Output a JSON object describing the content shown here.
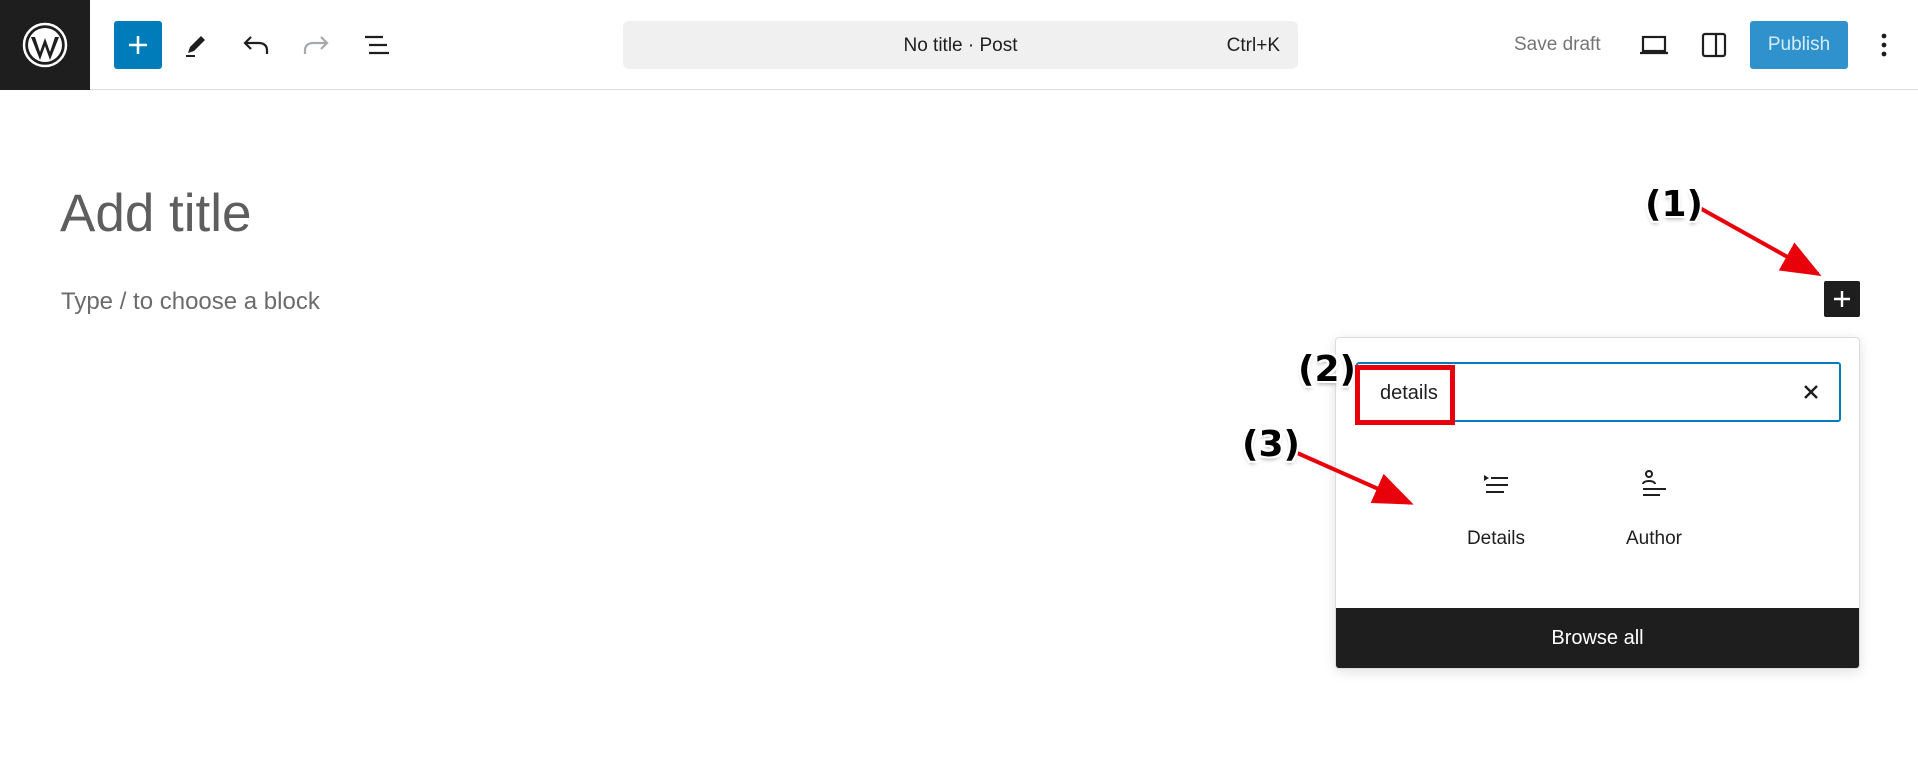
{
  "toolbar": {
    "logo_icon": "wordpress-logo-icon",
    "inserter_icon": "plus-icon",
    "tools_icon": "pencil-icon",
    "undo_icon": "undo-icon",
    "redo_icon": "redo-icon",
    "outline_icon": "list-view-icon",
    "command_title": "No title · Post",
    "command_shortcut": "Ctrl+K",
    "save_draft_label": "Save draft",
    "preview_icon": "desktop-preview-icon",
    "settings_icon": "sidebar-settings-icon",
    "publish_label": "Publish",
    "options_icon": "more-vertical-icon",
    "accent_color": "#007cba"
  },
  "editor": {
    "title_placeholder": "Add title",
    "block_placeholder": "Type / to choose a block",
    "inline_inserter_icon": "plus-icon"
  },
  "quick_inserter": {
    "search_value": "details",
    "clear_icon": "close-icon",
    "results": [
      {
        "label": "Details",
        "icon": "details-block-icon"
      },
      {
        "label": "Author",
        "icon": "author-block-icon"
      }
    ],
    "browse_all_label": "Browse all"
  },
  "annotations": {
    "step1": "(1)",
    "step2": "(2)",
    "step3": "(3)",
    "marker_color": "#e8000b"
  }
}
